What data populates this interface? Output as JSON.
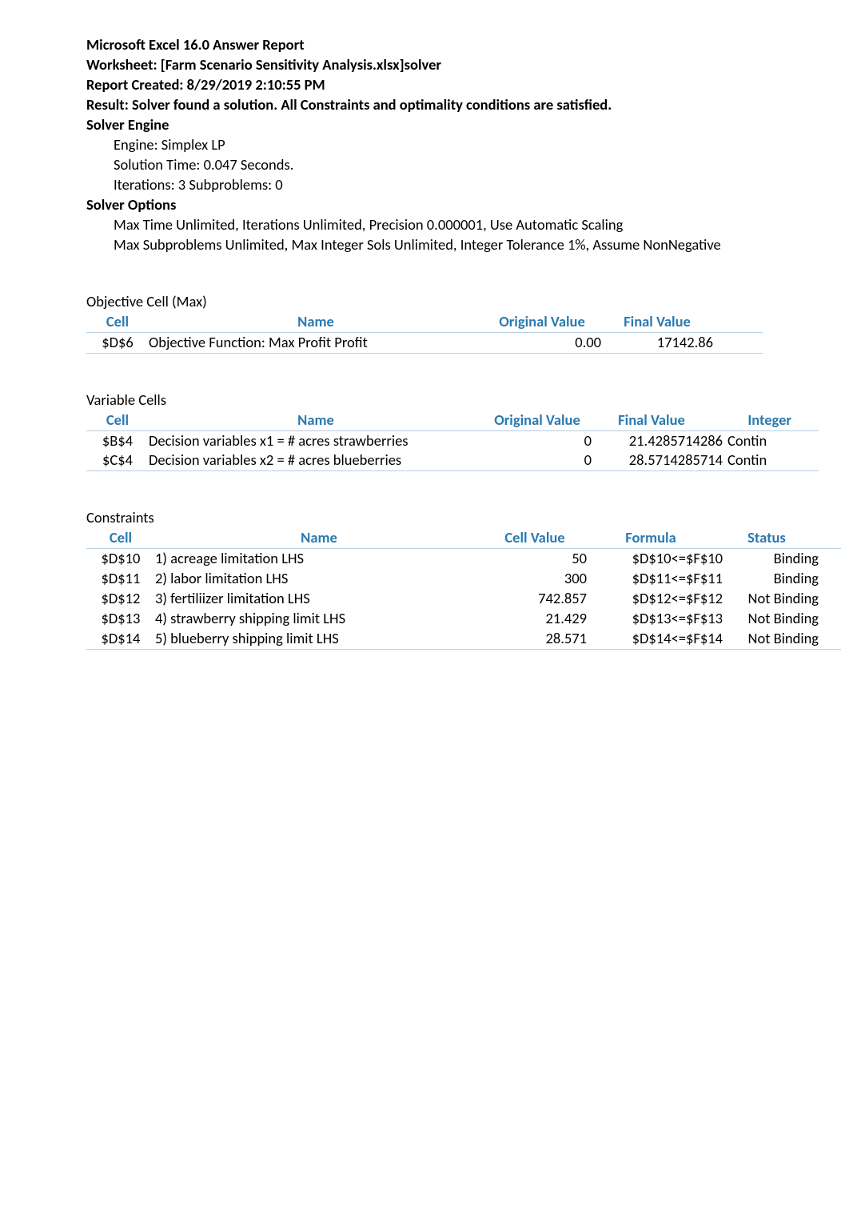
{
  "report": {
    "title": "Microsoft Excel 16.0 Answer Report",
    "worksheet": "Worksheet: [Farm Scenario Sensitivity Analysis.xlsx]solver",
    "created": "Report Created: 8/29/2019 2:10:55 PM",
    "result": "Result: Solver found a solution.  All Constraints and optimality conditions are satisfied.",
    "engine_title": "Solver Engine",
    "engine_name": "Engine: Simplex LP",
    "solution_time": "Solution Time: 0.047 Seconds.",
    "iterations": "Iterations: 3 Subproblems: 0",
    "options_title": "Solver Options",
    "options_line1": "Max Time Unlimited,  Iterations Unlimited, Precision 0.000001, Use Automatic Scaling",
    "options_line2": "Max Subproblems Unlimited, Max Integer Sols Unlimited, Integer Tolerance 1%, Assume NonNegative"
  },
  "objective": {
    "title": "Objective Cell (Max)",
    "headers": {
      "cell": "Cell",
      "name": "Name",
      "original": "Original Value",
      "final": "Final Value"
    },
    "row": {
      "cell": "$D$6",
      "name": "Objective Function: Max Profit Profit",
      "original": "0.00",
      "final": "17142.86"
    }
  },
  "variables": {
    "title": "Variable Cells",
    "headers": {
      "cell": "Cell",
      "name": "Name",
      "original": "Original Value",
      "final": "Final Value",
      "integer": "Integer"
    },
    "rows": [
      {
        "cell": "$B$4",
        "name": "Decision variables x1 = # acres strawberries",
        "original": "0",
        "final": "21.4285714286",
        "integer": "Contin"
      },
      {
        "cell": "$C$4",
        "name": "Decision variables x2 = # acres blueberries",
        "original": "0",
        "final": "28.5714285714",
        "integer": "Contin"
      }
    ]
  },
  "constraints": {
    "title": "Constraints",
    "headers": {
      "cell": "Cell",
      "name": "Name",
      "value": "Cell Value",
      "formula": "Formula",
      "status": "Status"
    },
    "rows": [
      {
        "cell": "$D$10",
        "name": "1)  acreage limitation LHS",
        "value": "50",
        "formula": "$D$10<=$F$10",
        "status": "Binding"
      },
      {
        "cell": "$D$11",
        "name": "2)  labor limitation LHS",
        "value": "300",
        "formula": "$D$11<=$F$11",
        "status": "Binding"
      },
      {
        "cell": "$D$12",
        "name": "3)  fertiliizer limitation LHS",
        "value": "742.857",
        "formula": "$D$12<=$F$12",
        "status": "Not Binding"
      },
      {
        "cell": "$D$13",
        "name": "4)  strawberry shipping limit LHS",
        "value": "21.429",
        "formula": "$D$13<=$F$13",
        "status": "Not Binding"
      },
      {
        "cell": "$D$14",
        "name": "5)  blueberry shipping limit LHS",
        "value": "28.571",
        "formula": "$D$14<=$F$14",
        "status": "Not Binding"
      }
    ]
  }
}
